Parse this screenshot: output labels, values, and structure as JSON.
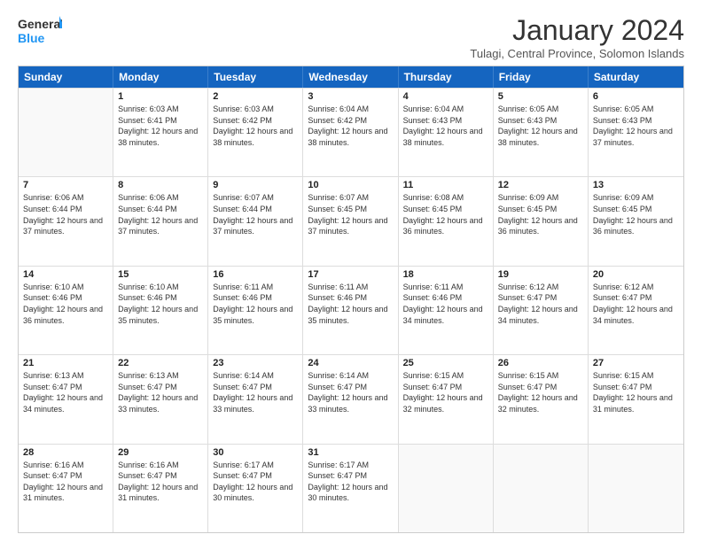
{
  "logo": {
    "general": "General",
    "blue": "Blue"
  },
  "title": "January 2024",
  "subtitle": "Tulagi, Central Province, Solomon Islands",
  "header_days": [
    "Sunday",
    "Monday",
    "Tuesday",
    "Wednesday",
    "Thursday",
    "Friday",
    "Saturday"
  ],
  "weeks": [
    [
      {
        "date": "",
        "sunrise": "",
        "sunset": "",
        "daylight": ""
      },
      {
        "date": "1",
        "sunrise": "Sunrise: 6:03 AM",
        "sunset": "Sunset: 6:41 PM",
        "daylight": "Daylight: 12 hours and 38 minutes."
      },
      {
        "date": "2",
        "sunrise": "Sunrise: 6:03 AM",
        "sunset": "Sunset: 6:42 PM",
        "daylight": "Daylight: 12 hours and 38 minutes."
      },
      {
        "date": "3",
        "sunrise": "Sunrise: 6:04 AM",
        "sunset": "Sunset: 6:42 PM",
        "daylight": "Daylight: 12 hours and 38 minutes."
      },
      {
        "date": "4",
        "sunrise": "Sunrise: 6:04 AM",
        "sunset": "Sunset: 6:43 PM",
        "daylight": "Daylight: 12 hours and 38 minutes."
      },
      {
        "date": "5",
        "sunrise": "Sunrise: 6:05 AM",
        "sunset": "Sunset: 6:43 PM",
        "daylight": "Daylight: 12 hours and 38 minutes."
      },
      {
        "date": "6",
        "sunrise": "Sunrise: 6:05 AM",
        "sunset": "Sunset: 6:43 PM",
        "daylight": "Daylight: 12 hours and 37 minutes."
      }
    ],
    [
      {
        "date": "7",
        "sunrise": "Sunrise: 6:06 AM",
        "sunset": "Sunset: 6:44 PM",
        "daylight": "Daylight: 12 hours and 37 minutes."
      },
      {
        "date": "8",
        "sunrise": "Sunrise: 6:06 AM",
        "sunset": "Sunset: 6:44 PM",
        "daylight": "Daylight: 12 hours and 37 minutes."
      },
      {
        "date": "9",
        "sunrise": "Sunrise: 6:07 AM",
        "sunset": "Sunset: 6:44 PM",
        "daylight": "Daylight: 12 hours and 37 minutes."
      },
      {
        "date": "10",
        "sunrise": "Sunrise: 6:07 AM",
        "sunset": "Sunset: 6:45 PM",
        "daylight": "Daylight: 12 hours and 37 minutes."
      },
      {
        "date": "11",
        "sunrise": "Sunrise: 6:08 AM",
        "sunset": "Sunset: 6:45 PM",
        "daylight": "Daylight: 12 hours and 36 minutes."
      },
      {
        "date": "12",
        "sunrise": "Sunrise: 6:09 AM",
        "sunset": "Sunset: 6:45 PM",
        "daylight": "Daylight: 12 hours and 36 minutes."
      },
      {
        "date": "13",
        "sunrise": "Sunrise: 6:09 AM",
        "sunset": "Sunset: 6:45 PM",
        "daylight": "Daylight: 12 hours and 36 minutes."
      }
    ],
    [
      {
        "date": "14",
        "sunrise": "Sunrise: 6:10 AM",
        "sunset": "Sunset: 6:46 PM",
        "daylight": "Daylight: 12 hours and 36 minutes."
      },
      {
        "date": "15",
        "sunrise": "Sunrise: 6:10 AM",
        "sunset": "Sunset: 6:46 PM",
        "daylight": "Daylight: 12 hours and 35 minutes."
      },
      {
        "date": "16",
        "sunrise": "Sunrise: 6:11 AM",
        "sunset": "Sunset: 6:46 PM",
        "daylight": "Daylight: 12 hours and 35 minutes."
      },
      {
        "date": "17",
        "sunrise": "Sunrise: 6:11 AM",
        "sunset": "Sunset: 6:46 PM",
        "daylight": "Daylight: 12 hours and 35 minutes."
      },
      {
        "date": "18",
        "sunrise": "Sunrise: 6:11 AM",
        "sunset": "Sunset: 6:46 PM",
        "daylight": "Daylight: 12 hours and 34 minutes."
      },
      {
        "date": "19",
        "sunrise": "Sunrise: 6:12 AM",
        "sunset": "Sunset: 6:47 PM",
        "daylight": "Daylight: 12 hours and 34 minutes."
      },
      {
        "date": "20",
        "sunrise": "Sunrise: 6:12 AM",
        "sunset": "Sunset: 6:47 PM",
        "daylight": "Daylight: 12 hours and 34 minutes."
      }
    ],
    [
      {
        "date": "21",
        "sunrise": "Sunrise: 6:13 AM",
        "sunset": "Sunset: 6:47 PM",
        "daylight": "Daylight: 12 hours and 34 minutes."
      },
      {
        "date": "22",
        "sunrise": "Sunrise: 6:13 AM",
        "sunset": "Sunset: 6:47 PM",
        "daylight": "Daylight: 12 hours and 33 minutes."
      },
      {
        "date": "23",
        "sunrise": "Sunrise: 6:14 AM",
        "sunset": "Sunset: 6:47 PM",
        "daylight": "Daylight: 12 hours and 33 minutes."
      },
      {
        "date": "24",
        "sunrise": "Sunrise: 6:14 AM",
        "sunset": "Sunset: 6:47 PM",
        "daylight": "Daylight: 12 hours and 33 minutes."
      },
      {
        "date": "25",
        "sunrise": "Sunrise: 6:15 AM",
        "sunset": "Sunset: 6:47 PM",
        "daylight": "Daylight: 12 hours and 32 minutes."
      },
      {
        "date": "26",
        "sunrise": "Sunrise: 6:15 AM",
        "sunset": "Sunset: 6:47 PM",
        "daylight": "Daylight: 12 hours and 32 minutes."
      },
      {
        "date": "27",
        "sunrise": "Sunrise: 6:15 AM",
        "sunset": "Sunset: 6:47 PM",
        "daylight": "Daylight: 12 hours and 31 minutes."
      }
    ],
    [
      {
        "date": "28",
        "sunrise": "Sunrise: 6:16 AM",
        "sunset": "Sunset: 6:47 PM",
        "daylight": "Daylight: 12 hours and 31 minutes."
      },
      {
        "date": "29",
        "sunrise": "Sunrise: 6:16 AM",
        "sunset": "Sunset: 6:47 PM",
        "daylight": "Daylight: 12 hours and 31 minutes."
      },
      {
        "date": "30",
        "sunrise": "Sunrise: 6:17 AM",
        "sunset": "Sunset: 6:47 PM",
        "daylight": "Daylight: 12 hours and 30 minutes."
      },
      {
        "date": "31",
        "sunrise": "Sunrise: 6:17 AM",
        "sunset": "Sunset: 6:47 PM",
        "daylight": "Daylight: 12 hours and 30 minutes."
      },
      {
        "date": "",
        "sunrise": "",
        "sunset": "",
        "daylight": ""
      },
      {
        "date": "",
        "sunrise": "",
        "sunset": "",
        "daylight": ""
      },
      {
        "date": "",
        "sunrise": "",
        "sunset": "",
        "daylight": ""
      }
    ]
  ]
}
